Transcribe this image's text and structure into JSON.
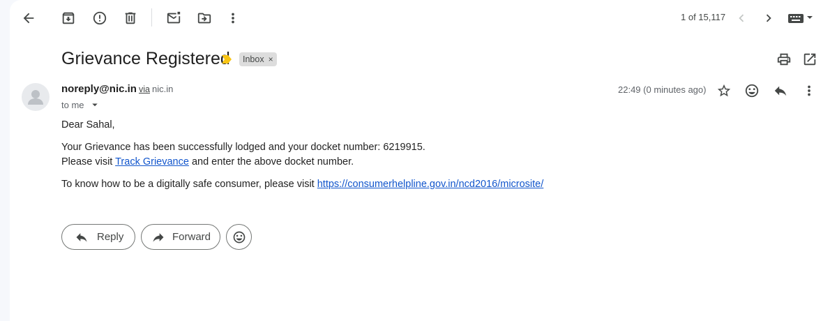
{
  "toolbar": {
    "back_icon": "arrow-back-icon",
    "archive_icon": "archive-icon",
    "spam_icon": "report-spam-icon",
    "delete_icon": "delete-icon",
    "unread_icon": "mark-unread-icon",
    "move_icon": "move-to-icon",
    "more_icon": "more-vert-icon",
    "counter": "1 of 15,117",
    "keyboard_icon": "keyboard-icon"
  },
  "message": {
    "subject": "Grievance Registered",
    "label": "Inbox",
    "label_remove": "×",
    "sender_name": "noreply@nic.in",
    "via": "via",
    "via_domain": "nic.in",
    "to": "to me",
    "time": "22:49 (0 minutes ago)",
    "greeting": "Dear Sahal,",
    "line1": "Your Grievance has been successfully lodged and your docket number: 6219915.",
    "line2_pre": "Please visit ",
    "line2_link": "Track Grievance",
    "line2_post": " and enter the above docket number.",
    "line3_pre": "To know how to be a digitally safe consumer, please visit ",
    "line3_link": "https://consumerhelpline.gov.in/ncd2016/microsite/"
  },
  "actions": {
    "reply_label": "Reply",
    "forward_label": "Forward"
  },
  "colors": {
    "link": "#1155cc",
    "importance_marker": "#f9c513",
    "label_chip": "#dddddd"
  }
}
